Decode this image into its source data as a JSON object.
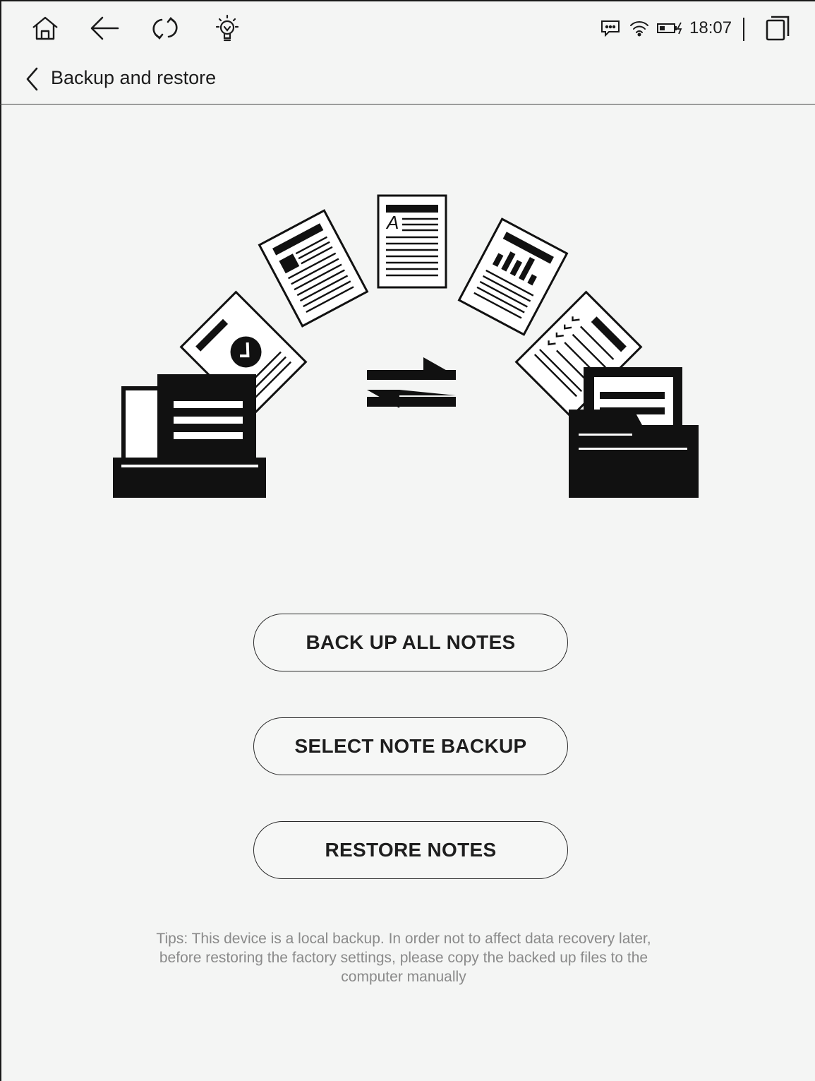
{
  "status_bar": {
    "icons": [
      "home-icon",
      "back-arrow-icon",
      "refresh-icon",
      "lightbulb-icon",
      "message-icon",
      "wifi-icon",
      "battery-charging-icon",
      "multiwindow-icon"
    ],
    "time": "18:07"
  },
  "header": {
    "title": "Backup and restore"
  },
  "actions": {
    "backup_all": "BACK UP ALL NOTES",
    "select_backup": "SELECT NOTE BACKUP",
    "restore": "RESTORE NOTES"
  },
  "tips": "Tips: This device is a local backup. In order not to affect data recovery later, before restoring the factory settings, please copy the backed up files to the computer manually"
}
